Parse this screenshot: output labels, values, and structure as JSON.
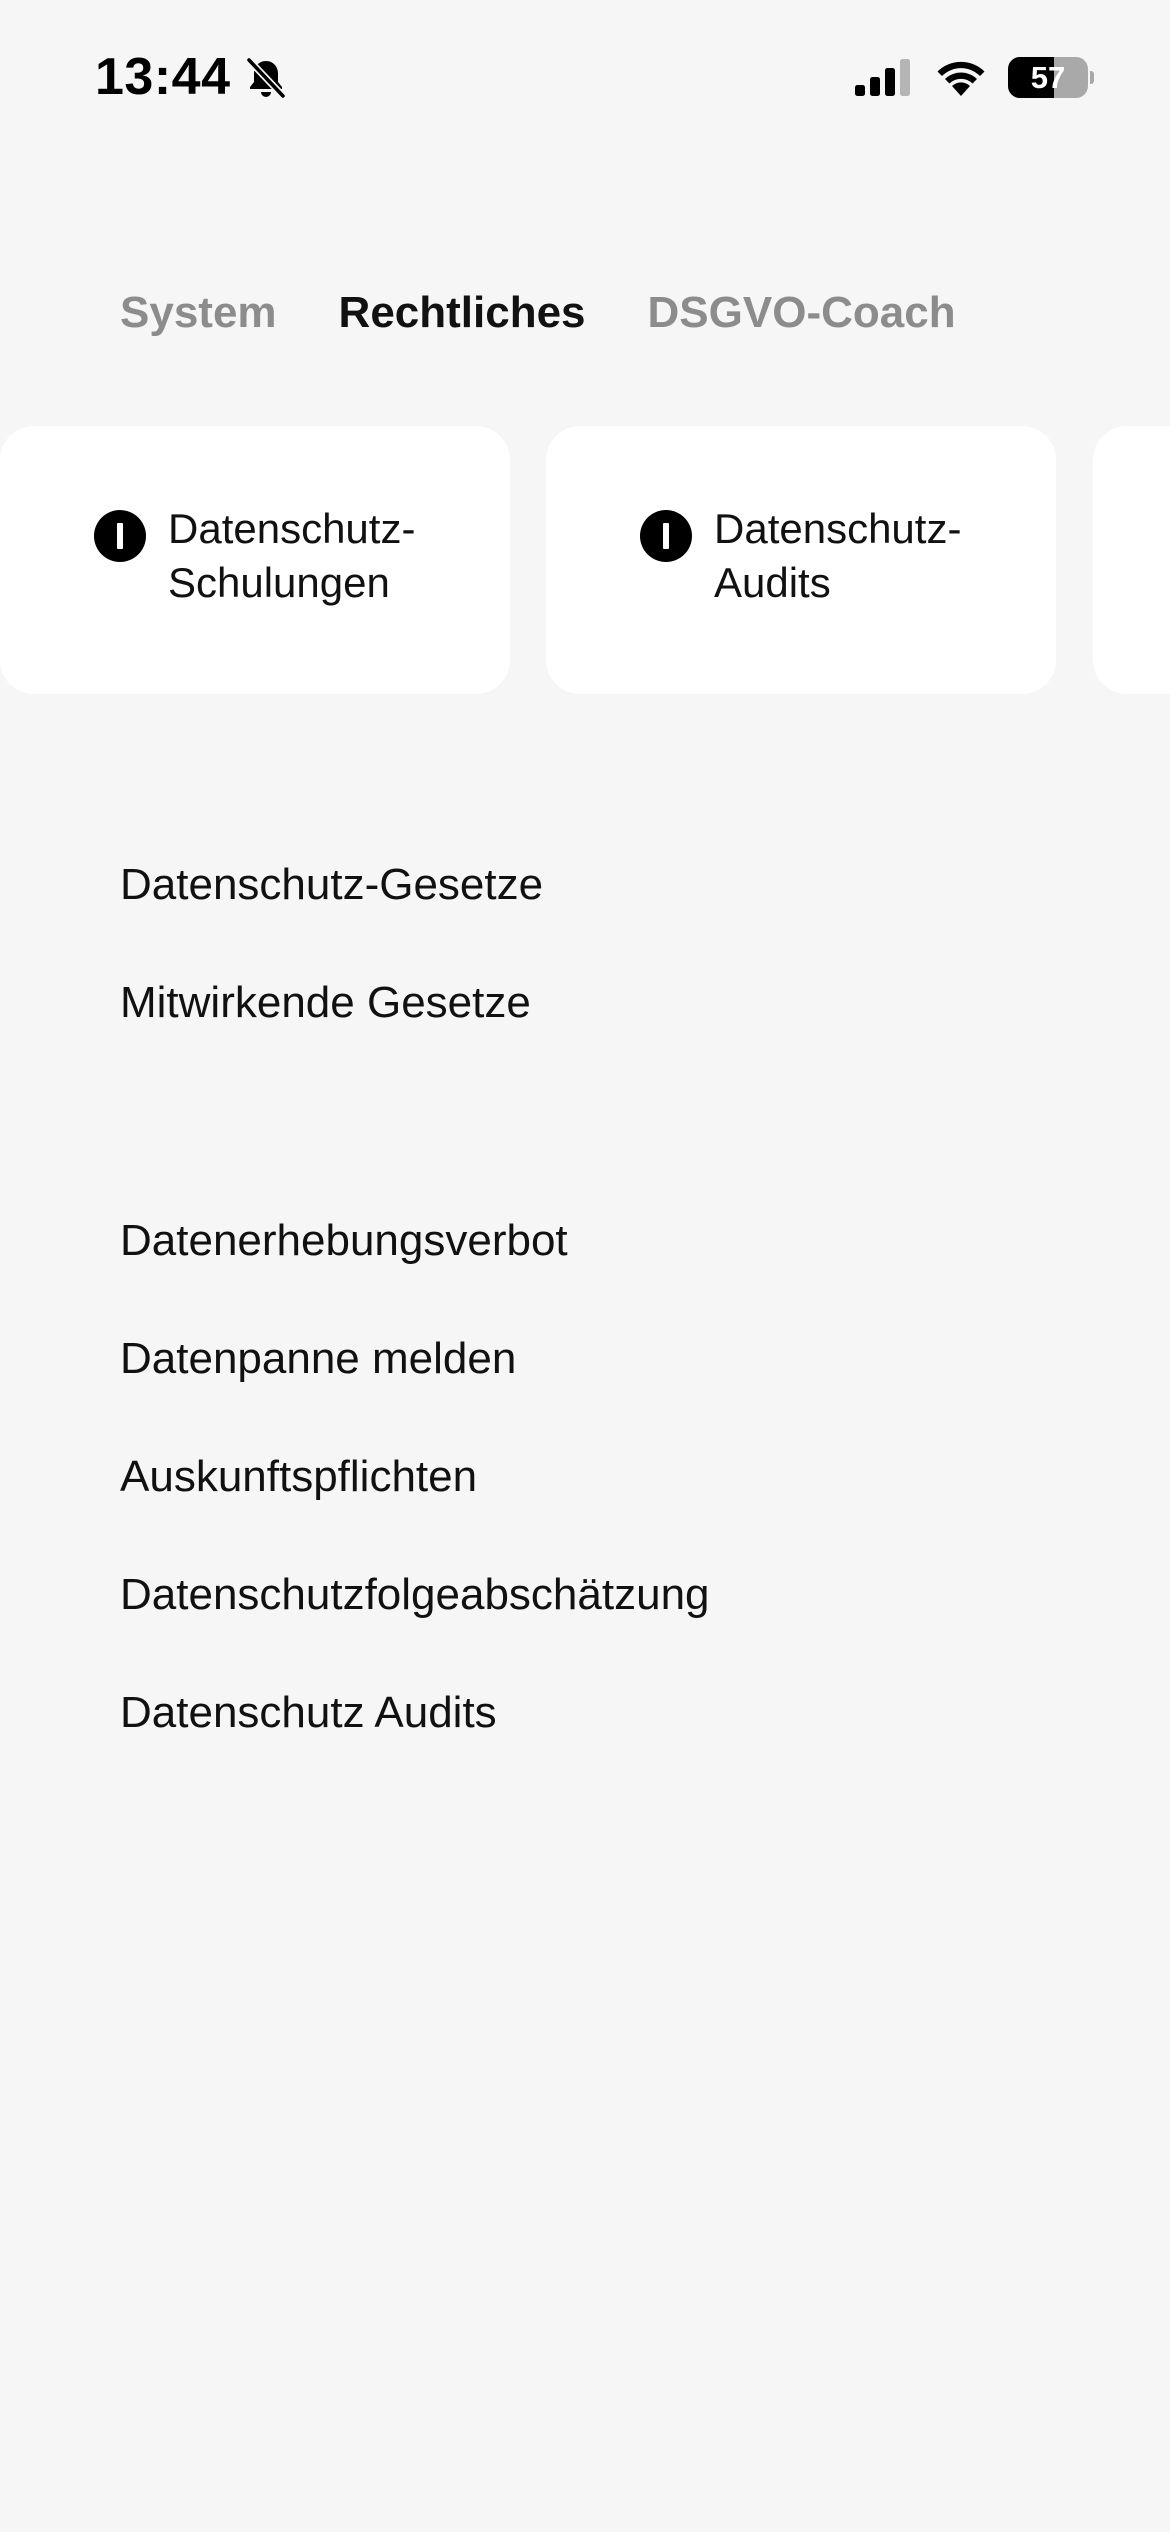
{
  "status_bar": {
    "time": "13:44",
    "battery_level": "57",
    "battery_fraction": 0.57,
    "icons": [
      "bell-slash-icon",
      "cellular-signal-icon",
      "wifi-icon",
      "battery-icon"
    ]
  },
  "tabs": [
    {
      "label": "System",
      "active": false
    },
    {
      "label": "Rechtliches",
      "active": true
    },
    {
      "label": "DSGVO-Coach",
      "active": false
    }
  ],
  "cards": [
    {
      "label": "Datenschutz-\nSchulungen",
      "icon": "info-icon"
    },
    {
      "label": "Datenschutz-\nAudits",
      "icon": "info-icon"
    },
    {
      "label": "",
      "icon": ""
    }
  ],
  "section_1": {
    "items": [
      {
        "label": "Datenschutz-Gesetze"
      },
      {
        "label": "Mitwirkende Gesetze"
      }
    ]
  },
  "section_2": {
    "items": [
      {
        "label": "Datenerhebungsverbot"
      },
      {
        "label": "Datenpanne melden"
      },
      {
        "label": "Auskunftspflichten"
      },
      {
        "label": "Datenschutzfolgeabschätzung"
      },
      {
        "label": "Datenschutz Audits"
      }
    ]
  },
  "colors": {
    "background": "#f6f6f6",
    "card": "#ffffff",
    "tab_active": "#111111",
    "tab_inactive": "#8c8c8c"
  }
}
